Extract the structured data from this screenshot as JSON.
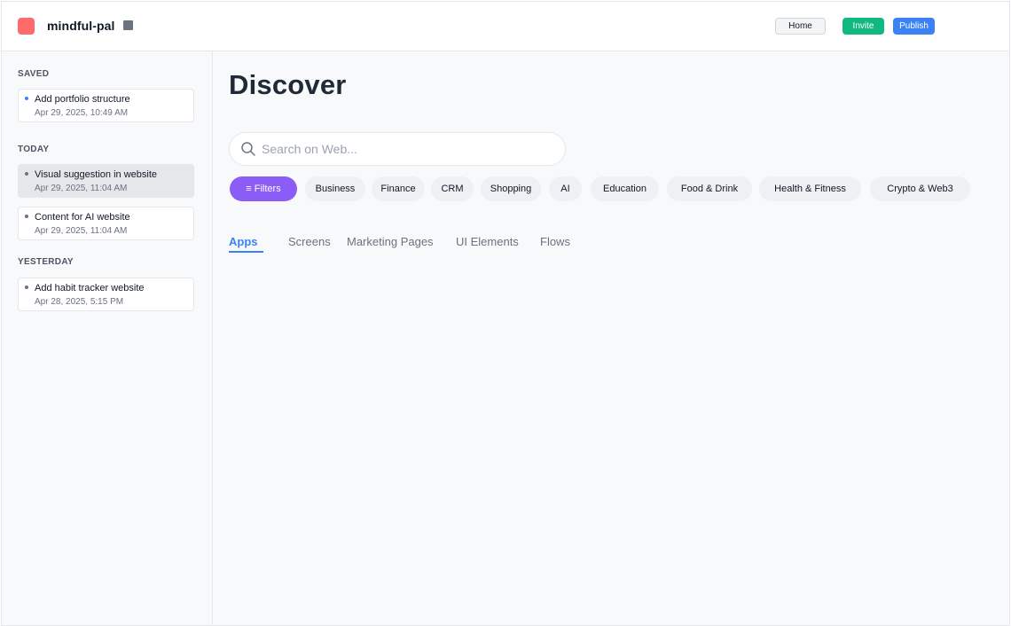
{
  "header": {
    "app_name": "mindful-pal",
    "buttons": {
      "home": "Home",
      "invite": "Invite",
      "publish": "Publish"
    },
    "colors": {
      "logo": "#ff6b6b",
      "invite": "#10b981",
      "publish": "#3b82f6"
    }
  },
  "sidebar": {
    "sections": [
      {
        "title": "SAVED",
        "items": [
          {
            "title": "Add portfolio structure",
            "time": "Apr 29, 2025, 10:49 AM"
          }
        ]
      },
      {
        "title": "TODAY",
        "items": [
          {
            "title": "Visual suggestion in website",
            "time": "Apr 29, 2025, 11:04 AM",
            "active": true
          },
          {
            "title": "Content for AI website",
            "time": "Apr 29, 2025, 11:04 AM"
          }
        ]
      },
      {
        "title": "YESTERDAY",
        "items": [
          {
            "title": "Add habit tracker website",
            "time": "Apr 28, 2025, 5:15 PM"
          }
        ]
      }
    ]
  },
  "main": {
    "title": "Discover",
    "search": {
      "placeholder": "Search on Web...",
      "value": ""
    },
    "filters_label": "≡ Filters",
    "categories": [
      "Business",
      "Finance",
      "CRM",
      "Shopping",
      "AI",
      "Education",
      "Food & Drink",
      "Health & Fitness",
      "Crypto & Web3"
    ],
    "tabs": [
      "Apps",
      "Screens",
      "Marketing Pages",
      "UI Elements",
      "Flows"
    ],
    "active_tab": "Apps",
    "colors": {
      "filters_chip": "#8b5cf6",
      "active_tab": "#3b82f6"
    }
  }
}
